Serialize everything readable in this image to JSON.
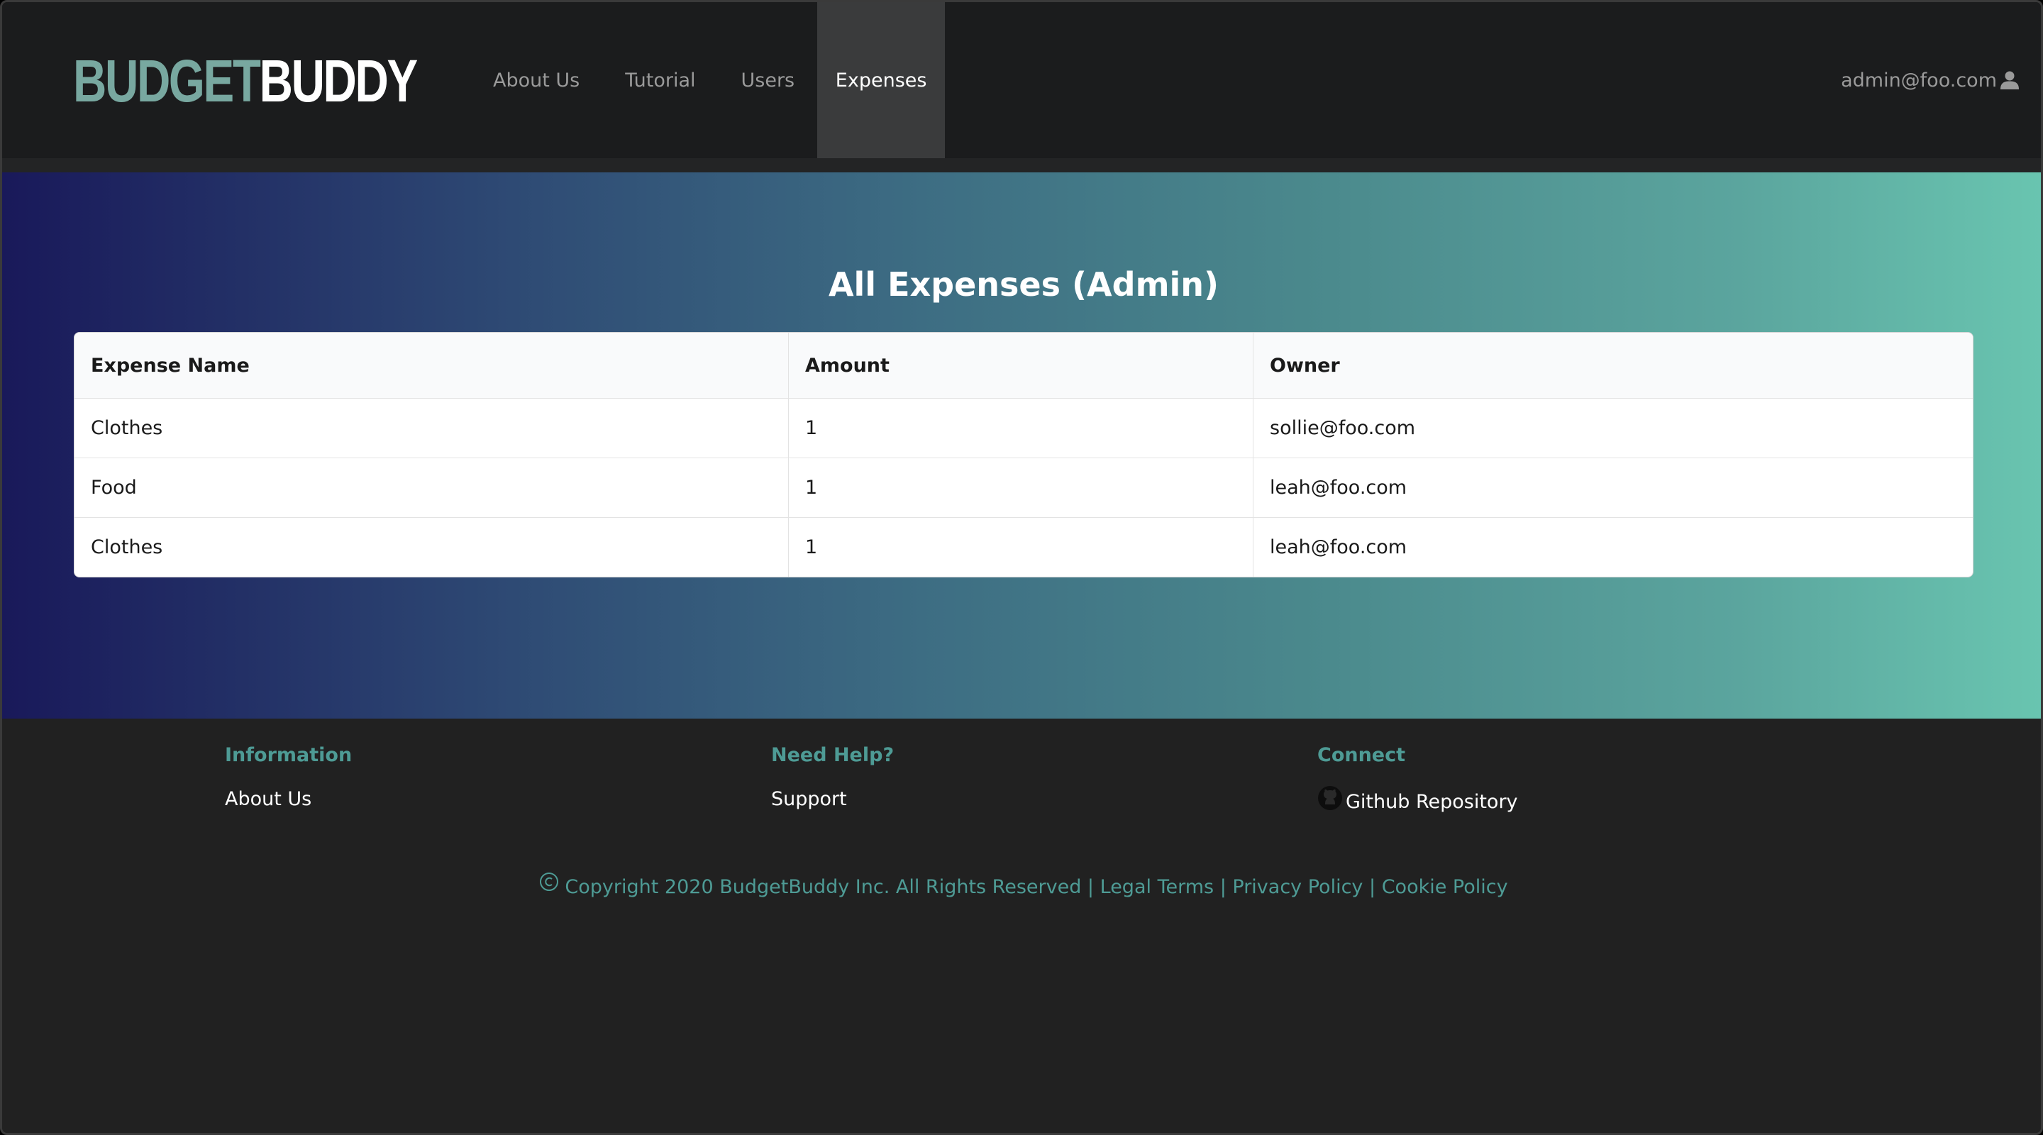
{
  "colors": {
    "logo_accent": "#78a8a0",
    "footer_accent": "#4e9b95",
    "navbar_bg": "#1b1c1d",
    "active_nav_bg": "#3a3b3c",
    "gradient_start": "#19195a",
    "gradient_end": "#69c5b0"
  },
  "navbar": {
    "logo": {
      "part1": "BUDGET",
      "part2": "BUDDY"
    },
    "items": [
      {
        "label": "About Us",
        "active": false
      },
      {
        "label": "Tutorial",
        "active": false
      },
      {
        "label": "Users",
        "active": false
      },
      {
        "label": "Expenses",
        "active": true
      }
    ],
    "user": {
      "email": "admin@foo.com",
      "icon": "user-icon"
    }
  },
  "main": {
    "title": "All Expenses (Admin)",
    "table": {
      "headers": [
        "Expense Name",
        "Amount",
        "Owner"
      ],
      "rows": [
        [
          "Clothes",
          "1",
          "sollie@foo.com"
        ],
        [
          "Food",
          "1",
          "leah@foo.com"
        ],
        [
          "Clothes",
          "1",
          "leah@foo.com"
        ]
      ]
    }
  },
  "footer": {
    "columns": [
      {
        "heading": "Information",
        "links": [
          "About Us"
        ]
      },
      {
        "heading": "Need Help?",
        "links": [
          "Support"
        ]
      },
      {
        "heading": "Connect",
        "links": [
          "Github Repository"
        ],
        "icon": "github-icon"
      }
    ],
    "copyright": {
      "text": "Copyright 2020 BudgetBuddy Inc. All Rights Reserved |",
      "links": [
        "Legal Terms",
        "Privacy Policy",
        "Cookie Policy"
      ],
      "separator": "|",
      "icon": "copyright-icon"
    }
  }
}
